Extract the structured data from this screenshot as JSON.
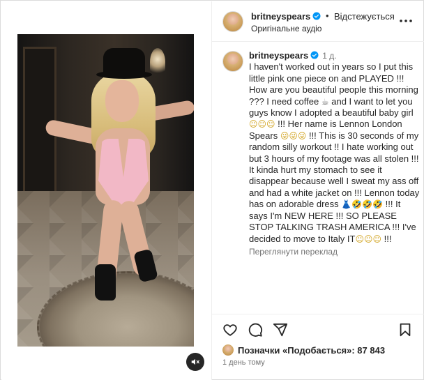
{
  "header": {
    "username": "britneyspears",
    "separator": "•",
    "follow_label": "Відстежується",
    "audio_label": "Оригінальне аудіо"
  },
  "caption": {
    "username": "britneyspears",
    "age": "1 д.",
    "text_1": "I haven't worked out in years so I put this little pink one piece on and PLAYED !!! How are you beautiful people this morning ??? I need coffee ",
    "text_2": " and I want to let you guys know I adopted a beautiful baby girl ",
    "text_3": " !!! Her name is Lennon London Spears ",
    "text_4": " !!! This is 30 seconds of my random silly workout !! I hate working out but 3 hours of my footage was all stolen !!! It kinda hurt my stomach to see it disappear because well I sweat my ass off and had a white jacket on !!!  Lennon today has on adorable dress ",
    "text_5": " !!! It says I'm NEW HERE !!! SO PLEASE STOP TALKING TRASH AMERICA !!! I've decided to move to Italy IT",
    "text_6": " !!!",
    "emoji_coffee": "☕",
    "emoji_smiles": "☺☺☺",
    "emoji_silly": "😜😜😜",
    "emoji_dress": "👗",
    "emoji_rofl": "🤣🤣🤣",
    "emoji_smiles_end": "☺☺☺",
    "translate_label": "Переглянути переклад"
  },
  "actions": {
    "like_icon": "heart-icon",
    "comment_icon": "comment-icon",
    "share_icon": "share-icon",
    "save_icon": "bookmark-icon"
  },
  "likes": {
    "label": "Позначки «Подобається»: 87 843"
  },
  "timestamp": "1 день тому",
  "colors": {
    "verified": "#0095f6",
    "text": "#262626",
    "muted": "#737373",
    "border": "#dbdbdb"
  }
}
